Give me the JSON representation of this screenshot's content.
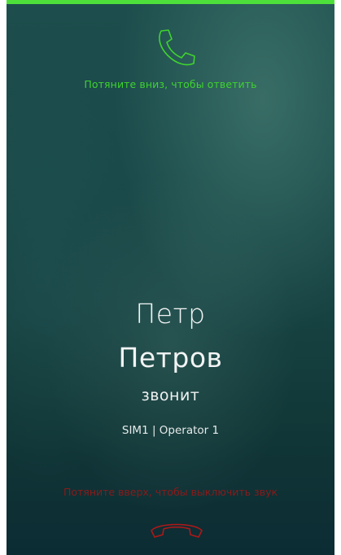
{
  "call": {
    "answer_hint": "Потяните вниз, чтобы ответить",
    "caller_first_name": "Петр",
    "caller_last_name": "Петров",
    "status": "звонит",
    "sim_info": "SIM1 | Operator 1",
    "silence_hint": "Потяните вверх, чтобы выключить звук"
  },
  "icons": {
    "answer": "phone-answer-icon",
    "hangup": "phone-hangup-icon"
  },
  "colors": {
    "accent_green": "#3fd32f",
    "top_bar": "#4ee03a",
    "decline_red": "#b01818",
    "background_dark": "#174343",
    "text": "#f2f4f4"
  }
}
